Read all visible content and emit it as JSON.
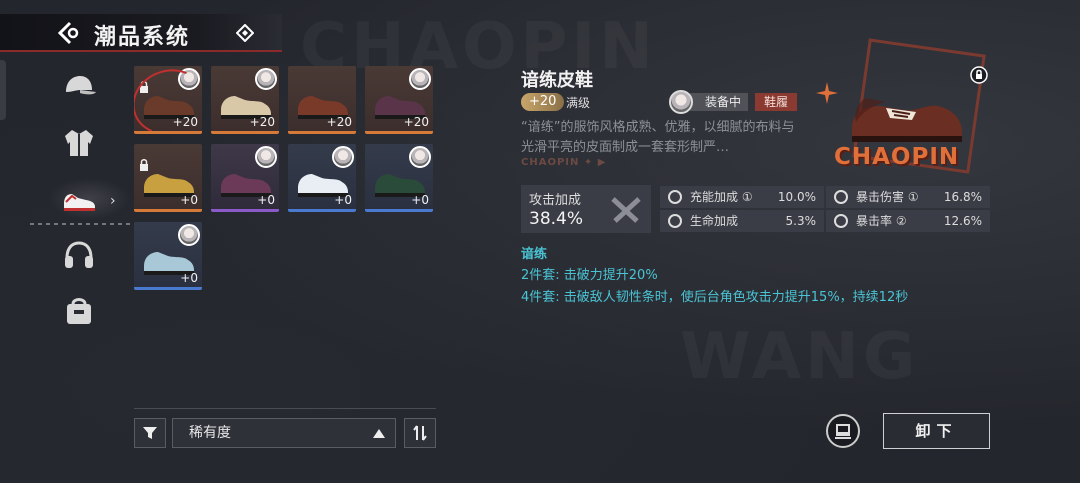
{
  "header": {
    "title": "潮品系统"
  },
  "sidebar": {
    "items": [
      {
        "icon": "cap-icon"
      },
      {
        "icon": "jacket-icon"
      },
      {
        "icon": "sneaker-icon",
        "active": true
      },
      {
        "icon": "headphones-icon"
      },
      {
        "icon": "bag-icon"
      }
    ]
  },
  "grid": {
    "items": [
      {
        "level": "+20",
        "rarity": "orange",
        "locked": true,
        "selected": true,
        "avatar": true,
        "color": "#6a3a2a"
      },
      {
        "level": "+20",
        "rarity": "orange",
        "locked": false,
        "avatar": true,
        "color": "#d8c8a8"
      },
      {
        "level": "+20",
        "rarity": "orange",
        "locked": false,
        "avatar": false,
        "color": "#7a3a2a"
      },
      {
        "level": "+20",
        "rarity": "orange",
        "locked": false,
        "avatar": true,
        "color": "#5a3448"
      },
      {
        "level": "+0",
        "rarity": "orange",
        "locked": true,
        "avatar": false,
        "color": "#c8a040"
      },
      {
        "level": "+0",
        "rarity": "purple",
        "locked": false,
        "avatar": true,
        "color": "#6a3a58"
      },
      {
        "level": "+0",
        "rarity": "blue",
        "locked": false,
        "avatar": true,
        "color": "#e8eef4"
      },
      {
        "level": "+0",
        "rarity": "blue",
        "locked": false,
        "avatar": true,
        "color": "#2a4a3a"
      },
      {
        "level": "+0",
        "rarity": "blue",
        "locked": false,
        "avatar": true,
        "color": "#a8c8d8"
      }
    ]
  },
  "filter": {
    "sort_label": "稀有度"
  },
  "detail": {
    "name": "谙练皮鞋",
    "level": "+20",
    "level_note": "满级",
    "equipped_label": "装备中",
    "type_label": "鞋履",
    "description": "“谙练”的服饰风格成熟、优雅，以细腻的布料与光滑平亮的皮面制成一套套形制严…",
    "brand_strip": "CHAOPIN ✦ ▶",
    "art_brand": "CHAOPIN",
    "main_stat": {
      "label": "攻击加成",
      "value": "38.4%"
    },
    "sub_stats": [
      {
        "name": "充能加成 ①",
        "value": "10.0%"
      },
      {
        "name": "暴击伤害 ①",
        "value": "16.8%"
      },
      {
        "name": "生命加成",
        "value": "5.3%"
      },
      {
        "name": "暴击率 ②",
        "value": "12.6%"
      }
    ],
    "set": {
      "name": "谙练",
      "bonus2": "2件套: 击破力提升20%",
      "bonus4": "4件套: 击破敌人韧性条时，使后台角色攻击力提升15%，持续12秒"
    }
  },
  "actions": {
    "unequip_label": "卸下"
  },
  "colors": {
    "accent_red": "#8a2a2a",
    "set_cyan": "#4ac4d4",
    "orange": "#d67a3a",
    "purple": "#8a5ac8",
    "blue": "#4a7ad0"
  }
}
